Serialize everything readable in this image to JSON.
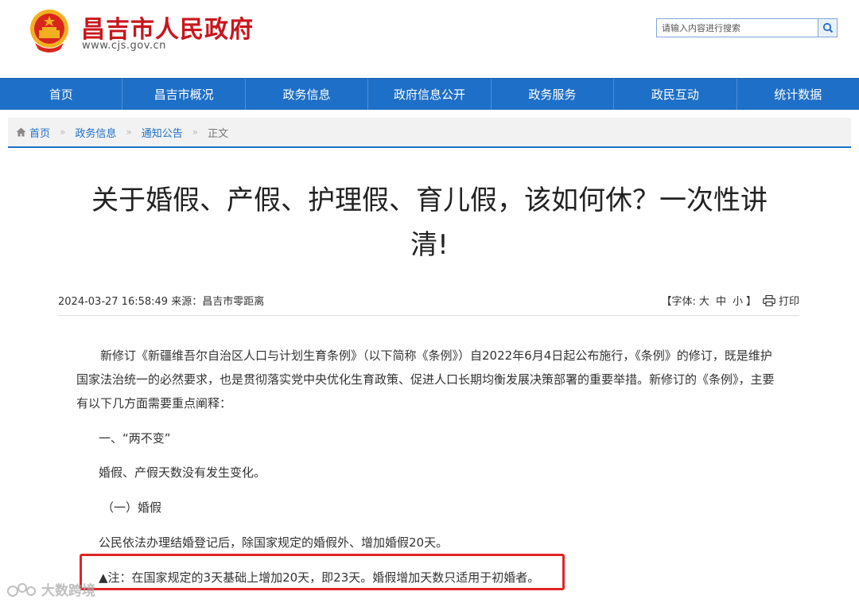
{
  "header": {
    "site_title": "昌吉市人民政府",
    "site_url": "www.cjs.gov.cn",
    "search_placeholder": "请输入内容进行搜索"
  },
  "nav": {
    "items": [
      "首页",
      "昌吉市概况",
      "政务信息",
      "政府信息公开",
      "政务服务",
      "政民互动",
      "统计数据"
    ]
  },
  "breadcrumb": {
    "items": [
      "首页",
      "政务信息",
      "通知公告"
    ],
    "current": "正文",
    "separator": "»"
  },
  "article": {
    "title_line1": "关于婚假、产假、护理假、育儿假，该如何休？一次性讲",
    "title_line2": "清!",
    "datetime": "2024-03-27 16:58:49",
    "source_label": "来源：",
    "source": "昌吉市零距离",
    "font_label_open": "【字体:",
    "font_large": "大",
    "font_medium": "中",
    "font_small": "小",
    "font_label_close": "】",
    "print_label": "打印",
    "paragraphs": {
      "intro": "新修订《新疆维吾尔自治区人口与计划生育条例》（以下简称《条例》）自2022年6月4日起公布施行，《条例》的修订，既是维护国家法治统一的必然要求，也是贯彻落实党中央优化生育政策、促进人口长期均衡发展决策部署的重要举措。新修订的《条例》，主要有以下几方面需要重点阐释：",
      "p1": "一、“两不变”",
      "p2": "婚假、产假天数没有发生变化。",
      "p3": "（一）婚假",
      "p4": "公民依法办理结婚登记后，除国家规定的婚假外、增加婚假20天。",
      "p5": "▲注：在国家规定的3天基础上增加20天，即23天。婚假增加天数只适用于初婚者。"
    }
  },
  "watermark": {
    "text": "大数跨境"
  },
  "colors": {
    "brand_red": "#c8161d",
    "nav_blue": "#1e6fc7",
    "highlight_red": "#e02424"
  }
}
